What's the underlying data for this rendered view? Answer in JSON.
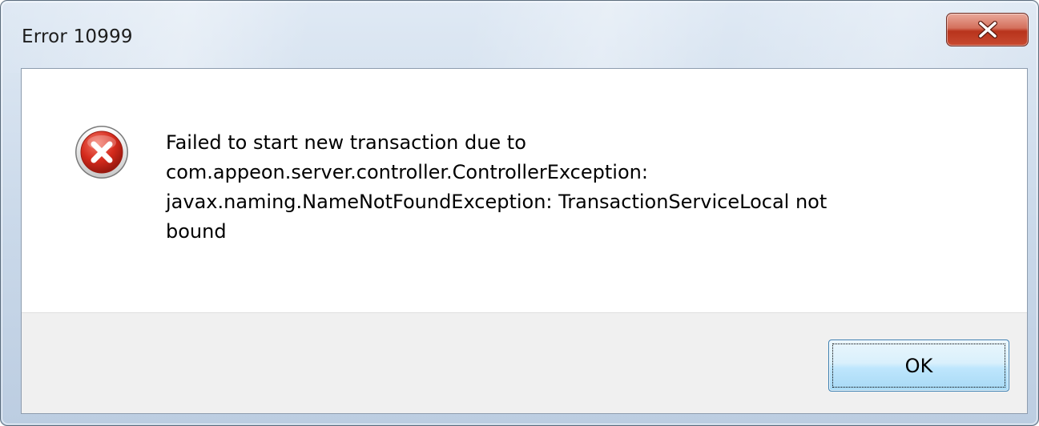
{
  "window": {
    "title": "Error 10999",
    "close_icon": "close-x-icon"
  },
  "dialog": {
    "icon": "error-icon",
    "message": "Failed to start new transaction due to\ncom.appeon.server.controller.ControllerException:\njavax.naming.NameNotFoundException: TransactionServiceLocal not\nbound"
  },
  "buttons": {
    "ok_label": "OK"
  },
  "colors": {
    "error_red": "#c8281c",
    "close_button": "#c84a30",
    "button_border": "#3c7fb1",
    "footer_bg": "#f0f0f0"
  }
}
